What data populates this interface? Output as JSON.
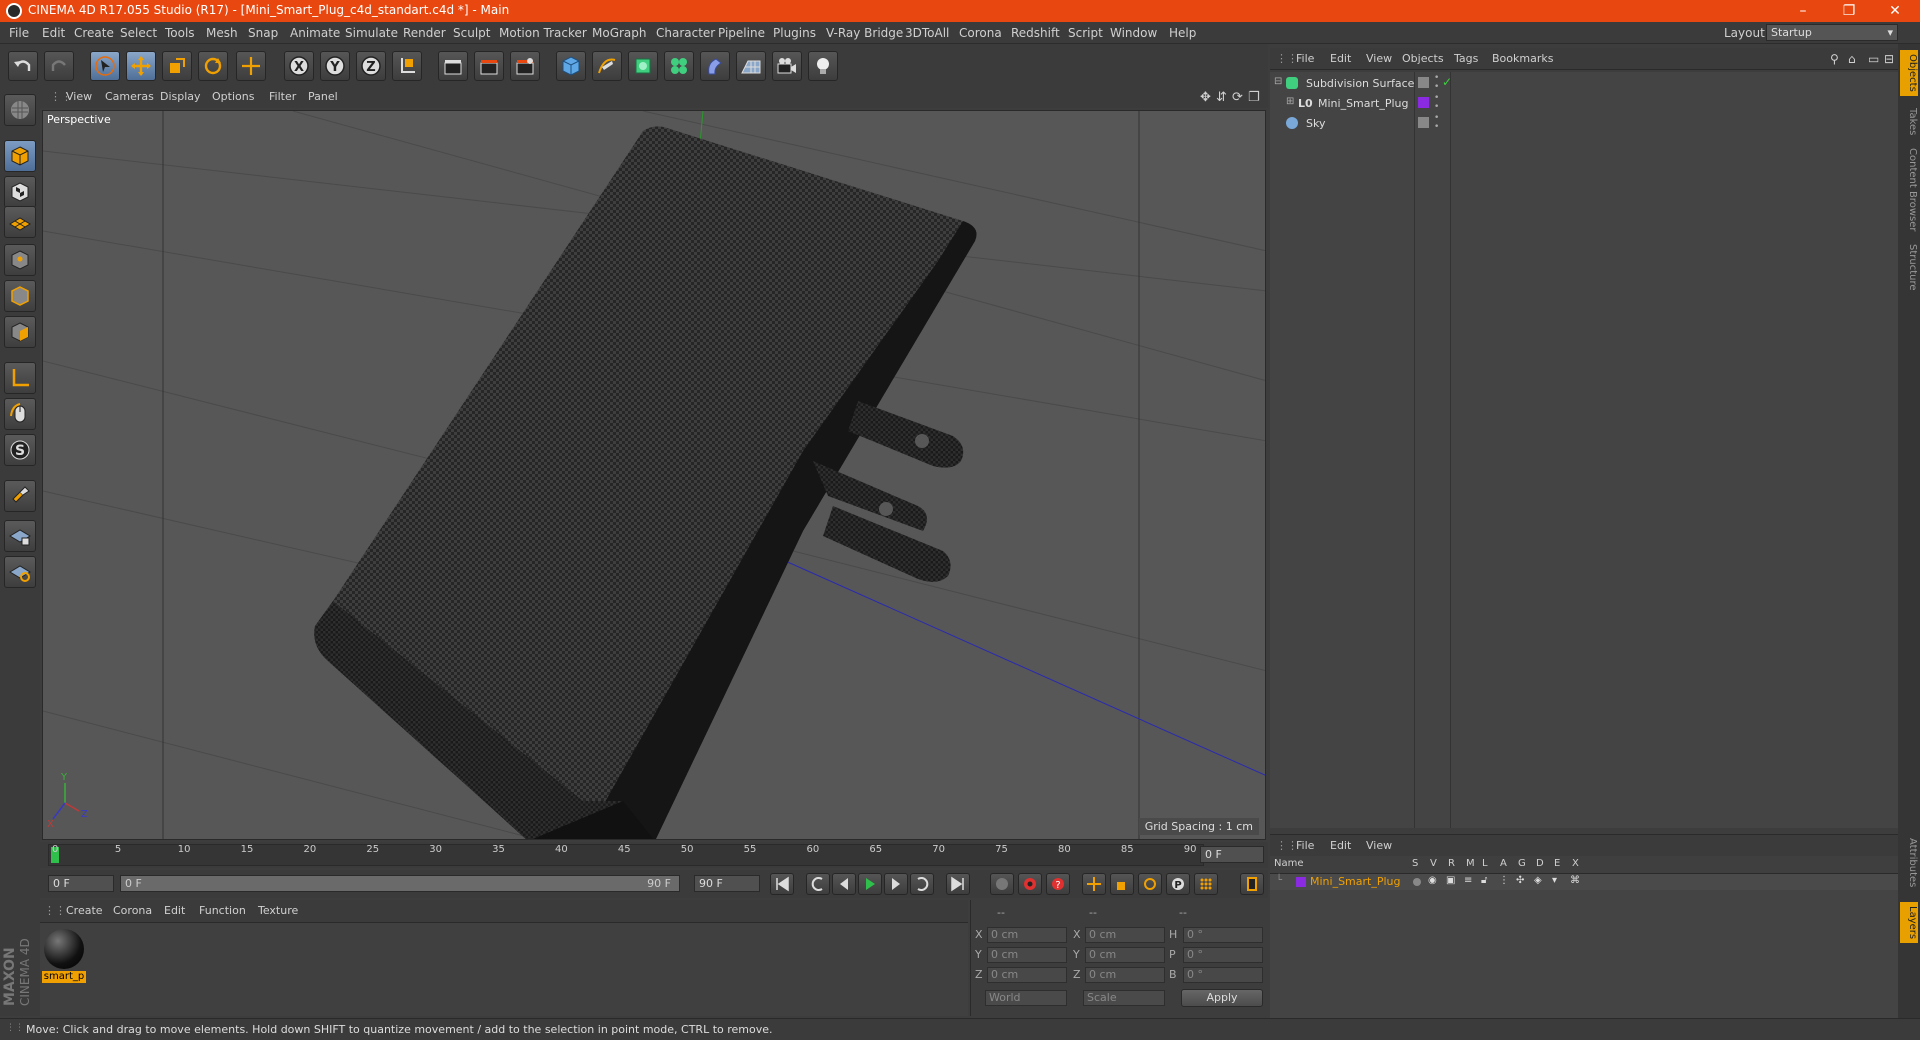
{
  "window": {
    "title": "CINEMA 4D R17.055 Studio (R17) - [Mini_Smart_Plug_c4d_standart.c4d *] - Main",
    "controls": [
      "–",
      "❐",
      "✕"
    ]
  },
  "menubar": {
    "items": [
      "File",
      "Edit",
      "Create",
      "Select",
      "Tools",
      "Mesh",
      "Snap",
      "Animate",
      "Simulate",
      "Render",
      "Sculpt",
      "Motion Tracker",
      "MoGraph",
      "Character",
      "Pipeline",
      "Plugins",
      "V-Ray Bridge",
      "3DToAll",
      "Corona",
      "Redshift",
      "Script",
      "Window",
      "Help"
    ],
    "layout_label": "Layout:",
    "layout_value": "Startup"
  },
  "viewport": {
    "menu": [
      "View",
      "Cameras",
      "Display",
      "Options",
      "Filter",
      "Panel"
    ],
    "camera_label": "Perspective",
    "grid_spacing": "Grid Spacing : 1 cm",
    "axis_labels": [
      "Y",
      "X",
      "Z"
    ]
  },
  "timeline": {
    "ticks": [
      "0",
      "5",
      "10",
      "15",
      "20",
      "25",
      "30",
      "35",
      "40",
      "45",
      "50",
      "55",
      "60",
      "65",
      "70",
      "75",
      "80",
      "85",
      "90"
    ],
    "current_frame": "0 F",
    "start_field": "0 F",
    "range_start": "0 F",
    "range_end": "90 F",
    "end_field": "90 F"
  },
  "material_manager": {
    "menu": [
      "Create",
      "Corona",
      "Edit",
      "Function",
      "Texture"
    ],
    "materials": [
      {
        "name": "smart_p"
      }
    ],
    "brand_top": "MAXON",
    "brand_bottom": "CINEMA 4D"
  },
  "coordinates": {
    "headers": [
      "--",
      "--",
      "--"
    ],
    "rows": [
      {
        "a": "X",
        "a_val": "0 cm",
        "b": "X",
        "b_val": "0 cm",
        "c": "H",
        "c_val": "0 °"
      },
      {
        "a": "Y",
        "a_val": "0 cm",
        "b": "Y",
        "b_val": "0 cm",
        "c": "P",
        "c_val": "0 °"
      },
      {
        "a": "Z",
        "a_val": "0 cm",
        "b": "Z",
        "b_val": "0 cm",
        "c": "B",
        "c_val": "0 °"
      }
    ],
    "space": "World",
    "mode": "Scale",
    "apply": "Apply"
  },
  "object_manager": {
    "menu": [
      "File",
      "Edit",
      "View",
      "Objects",
      "Tags",
      "Bookmarks"
    ],
    "objects": [
      {
        "name": "Subdivision Surface"
      },
      {
        "name": "Mini_Smart_Plug"
      },
      {
        "name": "Sky"
      }
    ]
  },
  "layer_manager": {
    "menu": [
      "File",
      "Edit",
      "View"
    ],
    "columns": [
      "Name",
      "S",
      "V",
      "R",
      "M",
      "L",
      "A",
      "G",
      "D",
      "E",
      "X"
    ],
    "layers": [
      {
        "name": "Mini_Smart_Plug",
        "color": "#8a2be2"
      }
    ]
  },
  "side_tabs": [
    "Objects",
    "Takes",
    "Content Browser",
    "Structure",
    "Attributes",
    "Layers"
  ],
  "status": "Move: Click and drag to move elements. Hold down SHIFT to quantize movement / add to the selection in point mode, CTRL to remove.",
  "colors": {
    "accent": "#e8470f",
    "layer": "#8a2be2",
    "material_label": "#f0a000"
  }
}
